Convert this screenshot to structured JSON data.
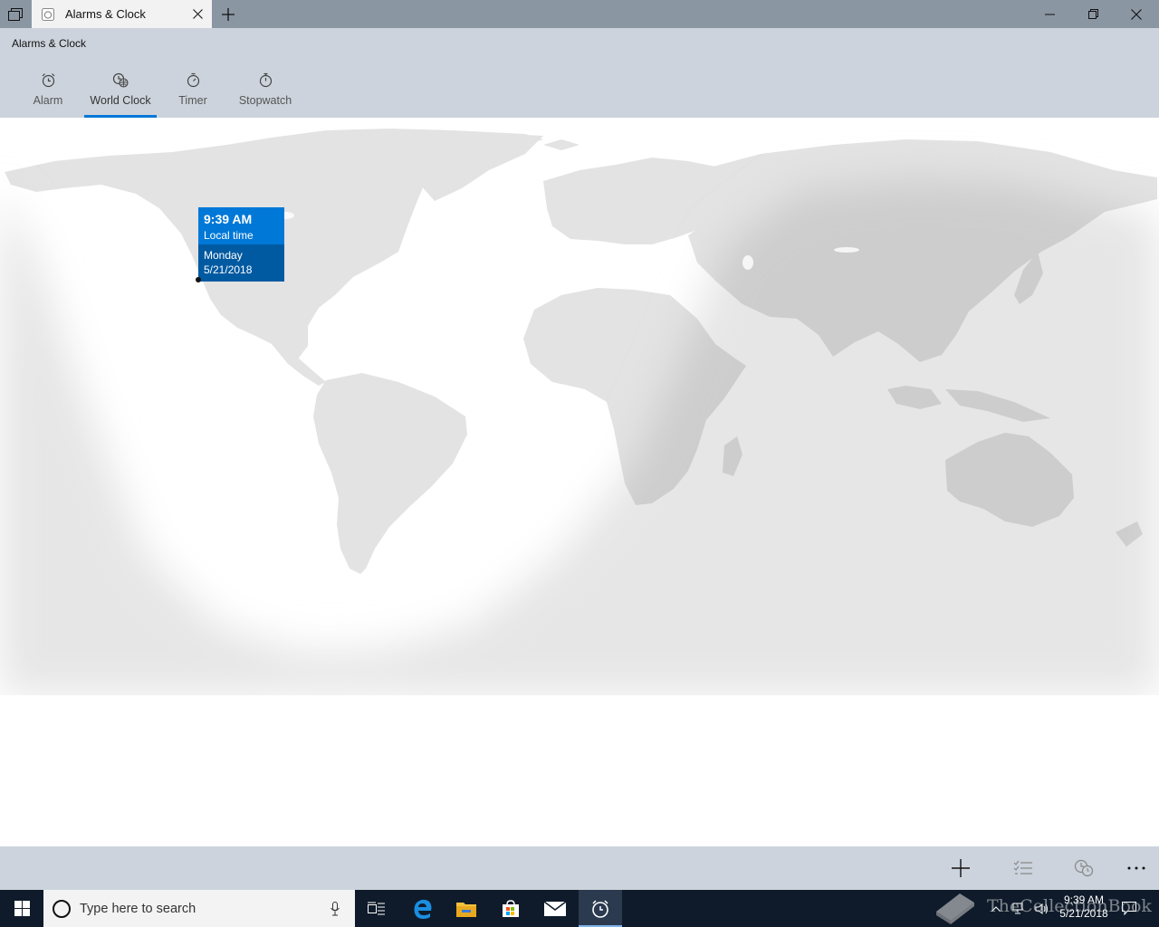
{
  "window": {
    "tab_title": "Alarms & Clock",
    "icons": {
      "sets": "tabs-icon",
      "tab": "alarm-clock-icon",
      "close_tab": "close-icon",
      "new_tab": "plus-icon",
      "minimize": "minimize-icon",
      "restore": "restore-icon",
      "close": "close-icon"
    }
  },
  "app": {
    "title": "Alarms & Clock",
    "nav": [
      {
        "label": "Alarm",
        "icon": "alarm-icon",
        "active": false
      },
      {
        "label": "World Clock",
        "icon": "world-clock-icon",
        "active": true
      },
      {
        "label": "Timer",
        "icon": "timer-icon",
        "active": false
      },
      {
        "label": "Stopwatch",
        "icon": "stopwatch-icon",
        "active": false
      }
    ],
    "accent": "#0078d7"
  },
  "map": {
    "callout": {
      "time": "9:39 AM",
      "label": "Local time",
      "day": "Monday",
      "date": "5/21/2018"
    },
    "colors": {
      "land": "#e3e3e3",
      "night": "#cfcfcf",
      "callout_top": "#0078d7",
      "callout_bottom": "#005aa1"
    }
  },
  "commandbar": {
    "buttons": [
      {
        "name": "add-button",
        "icon": "plus-icon"
      },
      {
        "name": "select-button",
        "icon": "checklist-icon"
      },
      {
        "name": "compare-button",
        "icon": "compare-clock-icon"
      },
      {
        "name": "more-button",
        "icon": "more-icon"
      }
    ]
  },
  "taskbar": {
    "search_placeholder": "Type here to search",
    "apps": [
      "task-view-icon",
      "edge-icon",
      "file-explorer-icon",
      "store-icon",
      "mail-icon",
      "alarms-clock-icon"
    ],
    "clock_time": "9:39 AM",
    "clock_date": "5/21/2018",
    "watermark": "TheCollectionBook"
  }
}
